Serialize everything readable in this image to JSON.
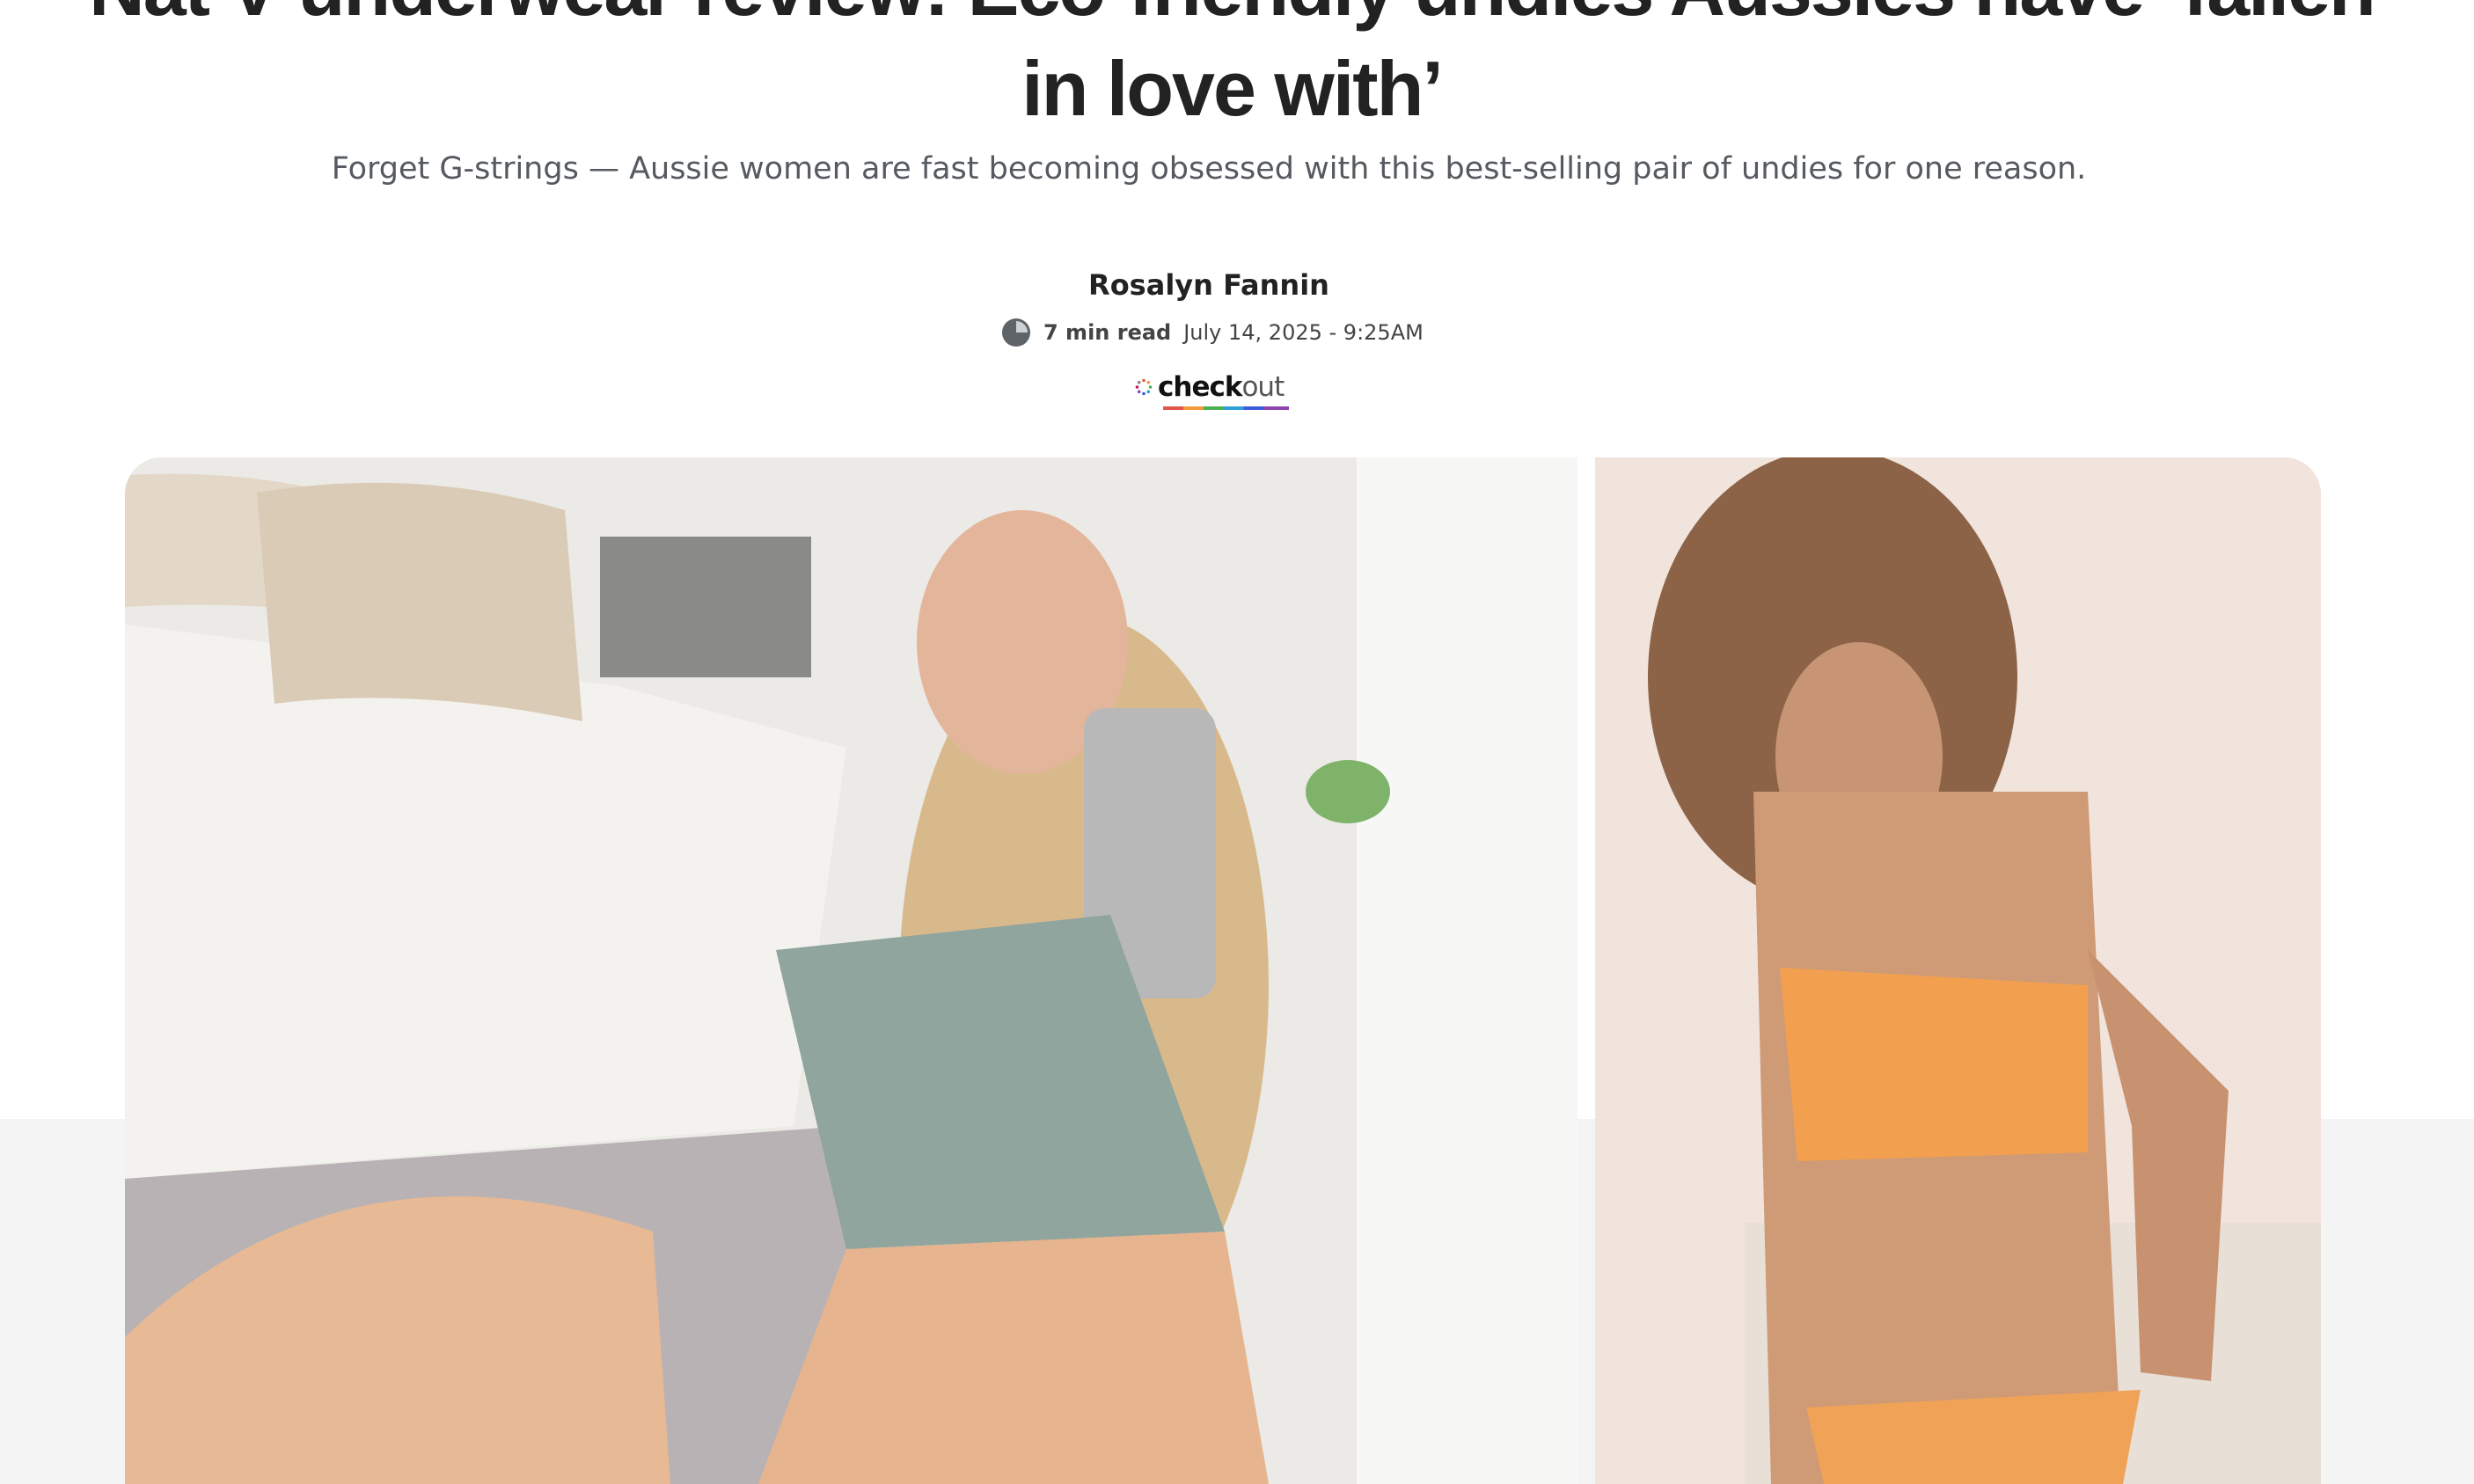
{
  "article": {
    "headline": "Nat V underwear review: Eco-friendly undies Aussies have ‘fallen in love with’",
    "subtitle": "Forget G-strings — Aussie women are fast becoming obsessed with this best-selling pair of undies for one reason.",
    "author": "Rosalyn Fannin",
    "read_time": "7 min read",
    "published": "July 14, 2025 - 9:25AM"
  },
  "brand": {
    "part1": "check",
    "part2": "out",
    "spinner_icon": "dotted-spinner-icon"
  },
  "icons": {
    "read_time": "clock-icon"
  },
  "hero": {
    "images": [
      {
        "name": "hero-image-left"
      },
      {
        "name": "hero-image-right"
      }
    ]
  },
  "colors": {
    "headline": "#222222",
    "subtitle": "#555a60",
    "page_bg": "#ffffff",
    "band_bg": "#f4f4f4"
  }
}
